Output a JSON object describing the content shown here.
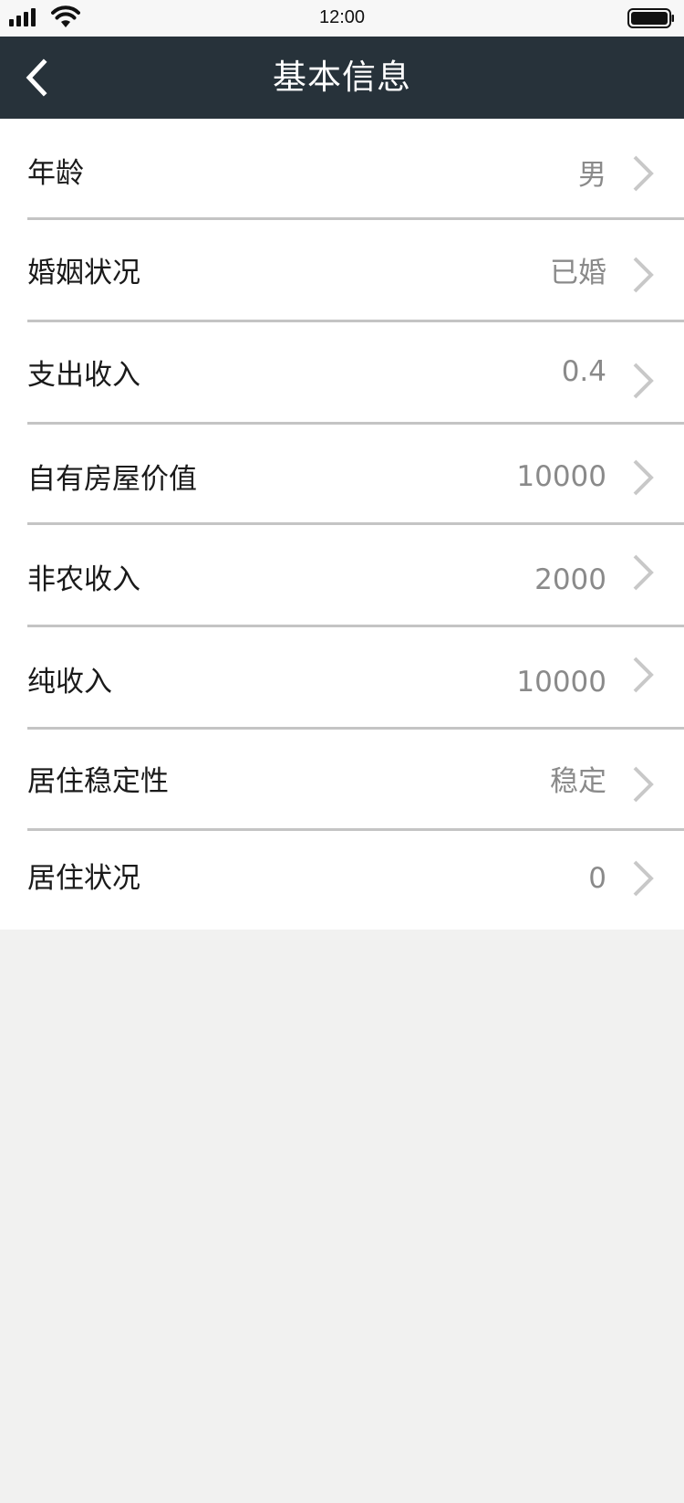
{
  "status_bar": {
    "time": "12:00"
  },
  "header": {
    "title": "基本信息",
    "back_icon": "chevron-left-icon"
  },
  "rows": [
    {
      "label": "年龄",
      "value": "男"
    },
    {
      "label": "婚姻状况",
      "value": "已婚"
    },
    {
      "label": "支出收入",
      "value": "0.4"
    },
    {
      "label": "自有房屋价值",
      "value": "10000"
    },
    {
      "label": "非农收入",
      "value": "2000"
    },
    {
      "label": "纯收入",
      "value": "10000"
    },
    {
      "label": "居住稳定性",
      "value": "稳定"
    },
    {
      "label": "居住状况",
      "value": "0"
    }
  ],
  "colors": {
    "header_bg": "#27323a",
    "page_bg": "#f1f1f0",
    "label_text": "#1a1a1a",
    "value_text": "#8a8a8a",
    "divider": "#c4c4c4",
    "chevron": "#c8c8c8"
  }
}
